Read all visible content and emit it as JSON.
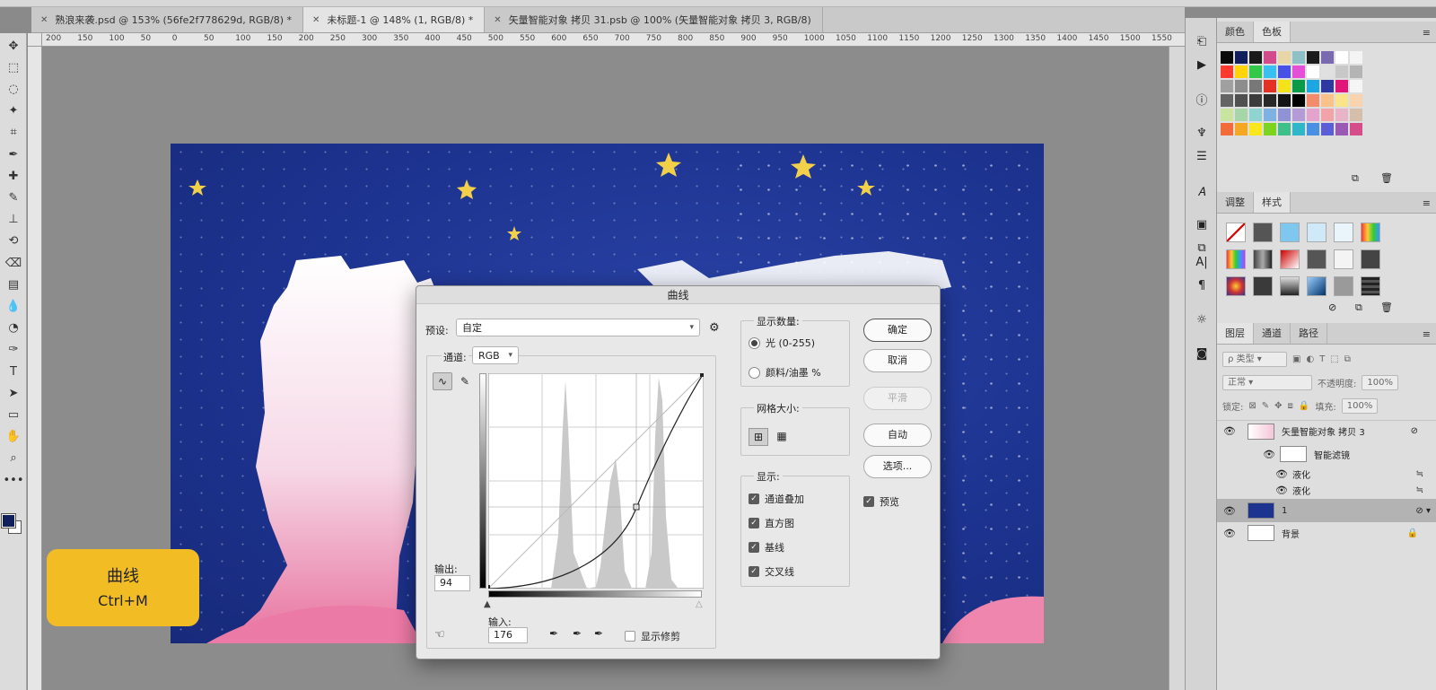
{
  "tabs": [
    {
      "label": "熟浪来袭.psd @ 153% (56fe2f778629d, RGB/8) *"
    },
    {
      "label": "未标题-1 @ 148% (1, RGB/8) *",
      "active": true
    },
    {
      "label": "矢量智能对象 拷贝 31.psb @ 100% (矢量智能对象 拷贝 3, RGB/8)"
    }
  ],
  "ruler_top": [
    "200",
    "150",
    "100",
    "50",
    "0",
    "50",
    "100",
    "150",
    "200",
    "250",
    "300",
    "350",
    "400",
    "450",
    "500",
    "550",
    "600",
    "650",
    "700",
    "750",
    "800",
    "850",
    "900",
    "950",
    "1000",
    "1050",
    "1100",
    "1150",
    "1200",
    "1250",
    "1300",
    "1350",
    "1400",
    "1450",
    "1500",
    "1550"
  ],
  "toolbar_icons": [
    "move-icon",
    "marquee-icon",
    "lasso-icon",
    "magic-wand-icon",
    "crop-icon",
    "eyedropper-icon",
    "healing-icon",
    "brush-icon",
    "stamp-icon",
    "history-brush-icon",
    "eraser-icon",
    "gradient-icon",
    "blur-icon",
    "dodge-icon",
    "pen-icon",
    "type-icon",
    "path-select-icon",
    "shape-icon",
    "hand-icon",
    "zoom-icon",
    "more-icon"
  ],
  "foreground_color": "#10205c",
  "dialog": {
    "title": "曲线",
    "preset_label": "预设:",
    "preset_value": "自定",
    "channel_label": "通道:",
    "channel_value": "RGB",
    "output_label": "输出:",
    "output_value": "94",
    "input_label": "输入:",
    "input_value": "176",
    "show_clipping": "显示修剪",
    "show_amount_title": "显示数量:",
    "light_option": "光 (0-255)",
    "pigment_option": "颜料/油墨 %",
    "grid_size_title": "网格大小:",
    "show_title": "显示:",
    "show_options": [
      "通道叠加",
      "直方图",
      "基线",
      "交叉线"
    ],
    "buttons": {
      "ok": "确定",
      "cancel": "取消",
      "smooth": "平滑",
      "auto": "自动",
      "options": "选项..."
    },
    "preview": "预览"
  },
  "badge": {
    "title": "曲线",
    "shortcut": "Ctrl+M"
  },
  "panels": {
    "color_tabs": [
      "颜色",
      "色板"
    ],
    "swatches": [
      "#0a0a0a",
      "#101f5c",
      "#1a1a1a",
      "#d14b8d",
      "#e8d5a8",
      "#8fc0c8",
      "#1b1b1b",
      "#7a6ab0",
      "#ffffff",
      "#f4f4f4",
      "#ff3b2f",
      "#ffd400",
      "#32c84a",
      "#39c0f0",
      "#4452e6",
      "#e54fd8",
      "#ffffff",
      "#e0e0e0",
      "#c8c8c8",
      "#b4b4b4",
      "#a0a0a0",
      "#8c8c8c",
      "#787878",
      "#e33125",
      "#f3e31b",
      "#0a9b46",
      "#1ea6e1",
      "#2f3aa1",
      "#e0167b",
      "#f5f5f5",
      "#646464",
      "#505050",
      "#3c3c3c",
      "#282828",
      "#141414",
      "#000000",
      "#f28c6c",
      "#f8c28a",
      "#fbe38a",
      "#f9d2b0",
      "#c9e4a0",
      "#a6d6a6",
      "#8fd3d3",
      "#7fb2e3",
      "#8f93d6",
      "#b49bd6",
      "#e2a3cf",
      "#f2a3a8",
      "#e8b4c8",
      "#d6bfa8",
      "#f26b3a",
      "#f5a623",
      "#f8e71c",
      "#7ed321",
      "#3fbf8a",
      "#2fb6c9",
      "#4a90e2",
      "#5a5fd6",
      "#9b59b6",
      "#d64d8c"
    ],
    "adjust_tabs": [
      "调整",
      "样式"
    ],
    "layer_tabs": [
      "图层",
      "通道",
      "路径"
    ],
    "filter_kind": "类型",
    "blend_mode": "正常",
    "opacity_label": "不透明度:",
    "opacity_value": "100%",
    "lock_label": "锁定:",
    "fill_label": "填充:",
    "fill_value": "100%",
    "layers": [
      {
        "name": "矢量智能对象 拷贝 3"
      },
      {
        "name": "智能滤镜"
      },
      {
        "name": "液化"
      },
      {
        "name": "液化"
      },
      {
        "name": "1",
        "selected": true
      },
      {
        "name": "背景"
      }
    ]
  }
}
